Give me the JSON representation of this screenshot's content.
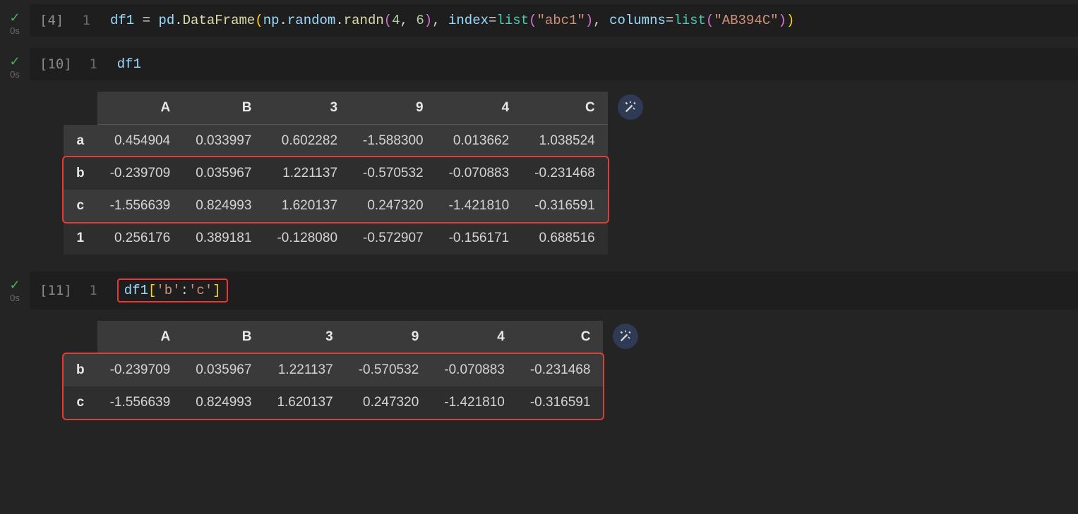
{
  "cells": [
    {
      "exec_count": "[4]",
      "timing": "0s",
      "lineno": "1",
      "code_tokens": [
        {
          "t": "df1",
          "c": "tok-var"
        },
        {
          "t": " ",
          "c": ""
        },
        {
          "t": "=",
          "c": "tok-op"
        },
        {
          "t": " ",
          "c": ""
        },
        {
          "t": "pd",
          "c": "tok-var"
        },
        {
          "t": ".",
          "c": "tok-op"
        },
        {
          "t": "DataFrame",
          "c": "tok-call"
        },
        {
          "t": "(",
          "c": "tok-brk"
        },
        {
          "t": "np",
          "c": "tok-var"
        },
        {
          "t": ".",
          "c": "tok-op"
        },
        {
          "t": "random",
          "c": "tok-var"
        },
        {
          "t": ".",
          "c": "tok-op"
        },
        {
          "t": "randn",
          "c": "tok-call"
        },
        {
          "t": "(",
          "c": "tok-brk2"
        },
        {
          "t": "4",
          "c": "tok-num"
        },
        {
          "t": ", ",
          "c": "tok-op"
        },
        {
          "t": "6",
          "c": "tok-num"
        },
        {
          "t": ")",
          "c": "tok-brk2"
        },
        {
          "t": ", ",
          "c": "tok-op"
        },
        {
          "t": "index",
          "c": "tok-var"
        },
        {
          "t": "=",
          "c": "tok-op"
        },
        {
          "t": "list",
          "c": "tok-fn"
        },
        {
          "t": "(",
          "c": "tok-brk2"
        },
        {
          "t": "\"abc1\"",
          "c": "tok-str"
        },
        {
          "t": ")",
          "c": "tok-brk2"
        },
        {
          "t": ", ",
          "c": "tok-op"
        },
        {
          "t": "columns",
          "c": "tok-var"
        },
        {
          "t": "=",
          "c": "tok-op"
        },
        {
          "t": "list",
          "c": "tok-fn"
        },
        {
          "t": "(",
          "c": "tok-brk2"
        },
        {
          "t": "\"AB394C\"",
          "c": "tok-str"
        },
        {
          "t": ")",
          "c": "tok-brk2"
        },
        {
          "t": ")",
          "c": "tok-brk"
        }
      ],
      "highlight_code": false,
      "output": null
    },
    {
      "exec_count": "[10]",
      "timing": "0s",
      "lineno": "1",
      "code_tokens": [
        {
          "t": "df1",
          "c": "tok-var"
        }
      ],
      "highlight_code": false,
      "output": {
        "columns": [
          "",
          "A",
          "B",
          "3",
          "9",
          "4",
          "C"
        ],
        "rows": [
          {
            "idx": "a",
            "vals": [
              "0.454904",
              "0.033997",
              "0.602282",
              "-1.588300",
              "0.013662",
              "1.038524"
            ],
            "hl": false
          },
          {
            "idx": "b",
            "vals": [
              "-0.239709",
              "0.035967",
              "1.221137",
              "-0.570532",
              "-0.070883",
              "-0.231468"
            ],
            "hl": true
          },
          {
            "idx": "c",
            "vals": [
              "-1.556639",
              "0.824993",
              "1.620137",
              "0.247320",
              "-1.421810",
              "-0.316591"
            ],
            "hl": true
          },
          {
            "idx": "1",
            "vals": [
              "0.256176",
              "0.389181",
              "-0.128080",
              "-0.572907",
              "-0.156171",
              "0.688516"
            ],
            "hl": false
          }
        ],
        "highlight_rows": [
          1,
          2
        ]
      }
    },
    {
      "exec_count": "[11]",
      "timing": "0s",
      "lineno": "1",
      "code_tokens": [
        {
          "t": "df1",
          "c": "tok-var"
        },
        {
          "t": "[",
          "c": "tok-brk"
        },
        {
          "t": "'b'",
          "c": "tok-str"
        },
        {
          "t": ":",
          "c": "tok-op"
        },
        {
          "t": "'c'",
          "c": "tok-str"
        },
        {
          "t": "]",
          "c": "tok-brk"
        }
      ],
      "highlight_code": true,
      "output": {
        "columns": [
          "",
          "A",
          "B",
          "3",
          "9",
          "4",
          "C"
        ],
        "rows": [
          {
            "idx": "b",
            "vals": [
              "-0.239709",
              "0.035967",
              "1.221137",
              "-0.570532",
              "-0.070883",
              "-0.231468"
            ],
            "hl": true
          },
          {
            "idx": "c",
            "vals": [
              "-1.556639",
              "0.824993",
              "1.620137",
              "0.247320",
              "-1.421810",
              "-0.316591"
            ],
            "hl": true
          }
        ],
        "highlight_rows": [
          0,
          1
        ]
      }
    }
  ],
  "icons": {
    "wand_name": "magic-wand-icon"
  }
}
